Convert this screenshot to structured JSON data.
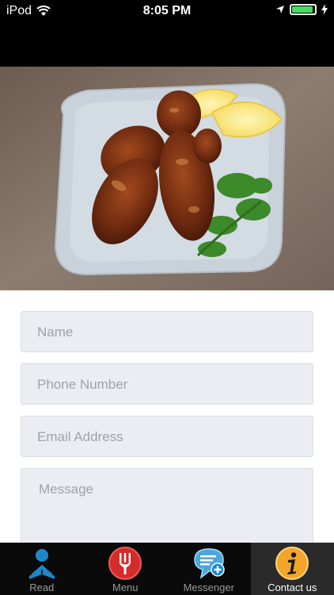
{
  "status_bar": {
    "carrier": "iPod",
    "time": "8:05 PM"
  },
  "form": {
    "name_placeholder": "Name",
    "phone_placeholder": "Phone Number",
    "email_placeholder": "Email Address",
    "message_placeholder": "Message"
  },
  "tabs": [
    {
      "label": "Read",
      "icon": "reader-icon"
    },
    {
      "label": "Menu",
      "icon": "fork-icon"
    },
    {
      "label": "Messenger",
      "icon": "chat-bubble-icon"
    },
    {
      "label": "Contact us",
      "icon": "info-icon",
      "active": true
    }
  ],
  "colors": {
    "battery": "#4cd964",
    "read_icon": "#1f86c9",
    "menu_icon": "#d62b2b",
    "messenger_icon": "#4aa7e0",
    "info_icon": "#f2a52a"
  }
}
